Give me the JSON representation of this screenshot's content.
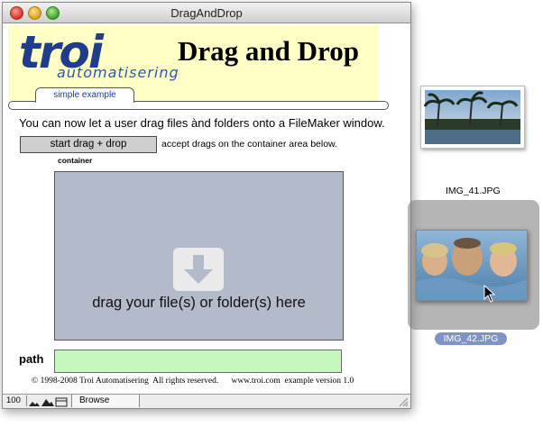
{
  "window": {
    "title": "DragAndDrop"
  },
  "header": {
    "logo_main": "troi",
    "logo_sub": "automatisering",
    "heading": "Drag and Drop",
    "tab_label": "simple example"
  },
  "content": {
    "intro": "You can now let a user drag files ànd folders onto a FileMaker window.",
    "start_button_label": "start drag + drop",
    "accept_note": "accept drags on the container area below.",
    "container_label": "container",
    "drop_text": "drag your file(s) or folder(s) here",
    "path_label": "path",
    "path_value": "",
    "footer": "© 1998-2008 Troi Automatisering  All rights reserved.      www.troi.com  example version 1.0"
  },
  "statusbar": {
    "zoom": "100",
    "mode": "Browse"
  },
  "desktop": {
    "files": [
      {
        "name": "IMG_41.JPG"
      },
      {
        "name": "IMG_42.JPG"
      }
    ]
  },
  "colors": {
    "header_band": "#ffffc6",
    "logo_blue": "#1f3d8a",
    "drop_zone": "#b3bac9",
    "path_field": "#c6f7c0",
    "selection_label": "#7f93c4"
  }
}
